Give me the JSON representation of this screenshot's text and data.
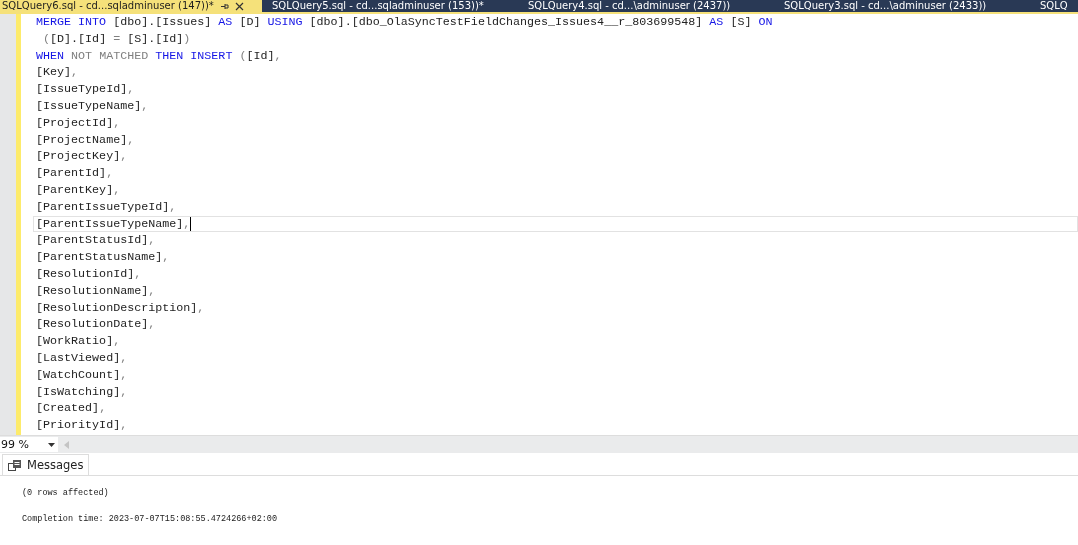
{
  "tabs": [
    {
      "label": "SQLQuery6.sql - cd...sqladminuser (147))*",
      "selected": true
    },
    {
      "label": "SQLQuery5.sql - cd...sqladminuser (153))*",
      "selected": false
    },
    {
      "label": "SQLQuery4.sql - cd...\\adminuser (2437))",
      "selected": false
    },
    {
      "label": "SQLQuery3.sql - cd...\\adminuser (2433))",
      "selected": false
    },
    {
      "label": "SQLQ",
      "selected": false
    }
  ],
  "editor": {
    "lines": [
      {
        "current": false,
        "tokens": [
          {
            "kind": "keyword",
            "text": "MERGE INTO"
          },
          {
            "kind": "plain",
            "text": " [dbo].[Issues] "
          },
          {
            "kind": "keyword",
            "text": "AS"
          },
          {
            "kind": "plain",
            "text": " [D] "
          },
          {
            "kind": "keyword",
            "text": "USING"
          },
          {
            "kind": "plain",
            "text": " [dbo].[dbo_OlaSyncTestFieldChanges_Issues4__r_803699548] "
          },
          {
            "kind": "keyword",
            "text": "AS"
          },
          {
            "kind": "plain",
            "text": " [S] "
          },
          {
            "kind": "keyword",
            "text": "ON"
          }
        ]
      },
      {
        "current": false,
        "tokens": [
          {
            "kind": "operator",
            "text": " ("
          },
          {
            "kind": "plain",
            "text": "[D].[Id] "
          },
          {
            "kind": "operator",
            "text": "="
          },
          {
            "kind": "plain",
            "text": " [S].[Id]"
          },
          {
            "kind": "operator",
            "text": ")"
          }
        ]
      },
      {
        "current": false,
        "tokens": [
          {
            "kind": "keyword",
            "text": "WHEN"
          },
          {
            "kind": "operator",
            "text": " NOT MATCHED "
          },
          {
            "kind": "keyword",
            "text": "THEN INSERT"
          },
          {
            "kind": "operator",
            "text": " ("
          },
          {
            "kind": "plain",
            "text": "[Id]"
          },
          {
            "kind": "operator",
            "text": ","
          }
        ]
      },
      {
        "current": false,
        "tokens": [
          {
            "kind": "plain",
            "text": "[Key]"
          },
          {
            "kind": "operator",
            "text": ","
          }
        ]
      },
      {
        "current": false,
        "tokens": [
          {
            "kind": "plain",
            "text": "[IssueTypeId]"
          },
          {
            "kind": "operator",
            "text": ","
          }
        ]
      },
      {
        "current": false,
        "tokens": [
          {
            "kind": "plain",
            "text": "[IssueTypeName]"
          },
          {
            "kind": "operator",
            "text": ","
          }
        ]
      },
      {
        "current": false,
        "tokens": [
          {
            "kind": "plain",
            "text": "[ProjectId]"
          },
          {
            "kind": "operator",
            "text": ","
          }
        ]
      },
      {
        "current": false,
        "tokens": [
          {
            "kind": "plain",
            "text": "[ProjectName]"
          },
          {
            "kind": "operator",
            "text": ","
          }
        ]
      },
      {
        "current": false,
        "tokens": [
          {
            "kind": "plain",
            "text": "[ProjectKey]"
          },
          {
            "kind": "operator",
            "text": ","
          }
        ]
      },
      {
        "current": false,
        "tokens": [
          {
            "kind": "plain",
            "text": "[ParentId]"
          },
          {
            "kind": "operator",
            "text": ","
          }
        ]
      },
      {
        "current": false,
        "tokens": [
          {
            "kind": "plain",
            "text": "[ParentKey]"
          },
          {
            "kind": "operator",
            "text": ","
          }
        ]
      },
      {
        "current": false,
        "tokens": [
          {
            "kind": "plain",
            "text": "[ParentIssueTypeId]"
          },
          {
            "kind": "operator",
            "text": ","
          }
        ]
      },
      {
        "current": true,
        "tokens": [
          {
            "kind": "plain",
            "text": "[ParentIssueTypeName]"
          },
          {
            "kind": "operator",
            "text": ","
          }
        ]
      },
      {
        "current": false,
        "tokens": [
          {
            "kind": "plain",
            "text": "[ParentStatusId]"
          },
          {
            "kind": "operator",
            "text": ","
          }
        ]
      },
      {
        "current": false,
        "tokens": [
          {
            "kind": "plain",
            "text": "[ParentStatusName]"
          },
          {
            "kind": "operator",
            "text": ","
          }
        ]
      },
      {
        "current": false,
        "tokens": [
          {
            "kind": "plain",
            "text": "[ResolutionId]"
          },
          {
            "kind": "operator",
            "text": ","
          }
        ]
      },
      {
        "current": false,
        "tokens": [
          {
            "kind": "plain",
            "text": "[ResolutionName]"
          },
          {
            "kind": "operator",
            "text": ","
          }
        ]
      },
      {
        "current": false,
        "tokens": [
          {
            "kind": "plain",
            "text": "[ResolutionDescription]"
          },
          {
            "kind": "operator",
            "text": ","
          }
        ]
      },
      {
        "current": false,
        "tokens": [
          {
            "kind": "plain",
            "text": "[ResolutionDate]"
          },
          {
            "kind": "operator",
            "text": ","
          }
        ]
      },
      {
        "current": false,
        "tokens": [
          {
            "kind": "plain",
            "text": "[WorkRatio]"
          },
          {
            "kind": "operator",
            "text": ","
          }
        ]
      },
      {
        "current": false,
        "tokens": [
          {
            "kind": "plain",
            "text": "[LastViewed]"
          },
          {
            "kind": "operator",
            "text": ","
          }
        ]
      },
      {
        "current": false,
        "tokens": [
          {
            "kind": "plain",
            "text": "[WatchCount]"
          },
          {
            "kind": "operator",
            "text": ","
          }
        ]
      },
      {
        "current": false,
        "tokens": [
          {
            "kind": "plain",
            "text": "[IsWatching]"
          },
          {
            "kind": "operator",
            "text": ","
          }
        ]
      },
      {
        "current": false,
        "tokens": [
          {
            "kind": "plain",
            "text": "[Created]"
          },
          {
            "kind": "operator",
            "text": ","
          }
        ]
      },
      {
        "current": false,
        "tokens": [
          {
            "kind": "plain",
            "text": "[PriorityId]"
          },
          {
            "kind": "operator",
            "text": ","
          }
        ]
      }
    ]
  },
  "zoom": {
    "value": "99 %"
  },
  "results": {
    "tabs": [
      {
        "label": "Messages",
        "selected": true
      }
    ],
    "messages": [
      "(0 rows affected)",
      "Completion time: 2023-07-07T15:08:55.4724266+02:00"
    ]
  }
}
